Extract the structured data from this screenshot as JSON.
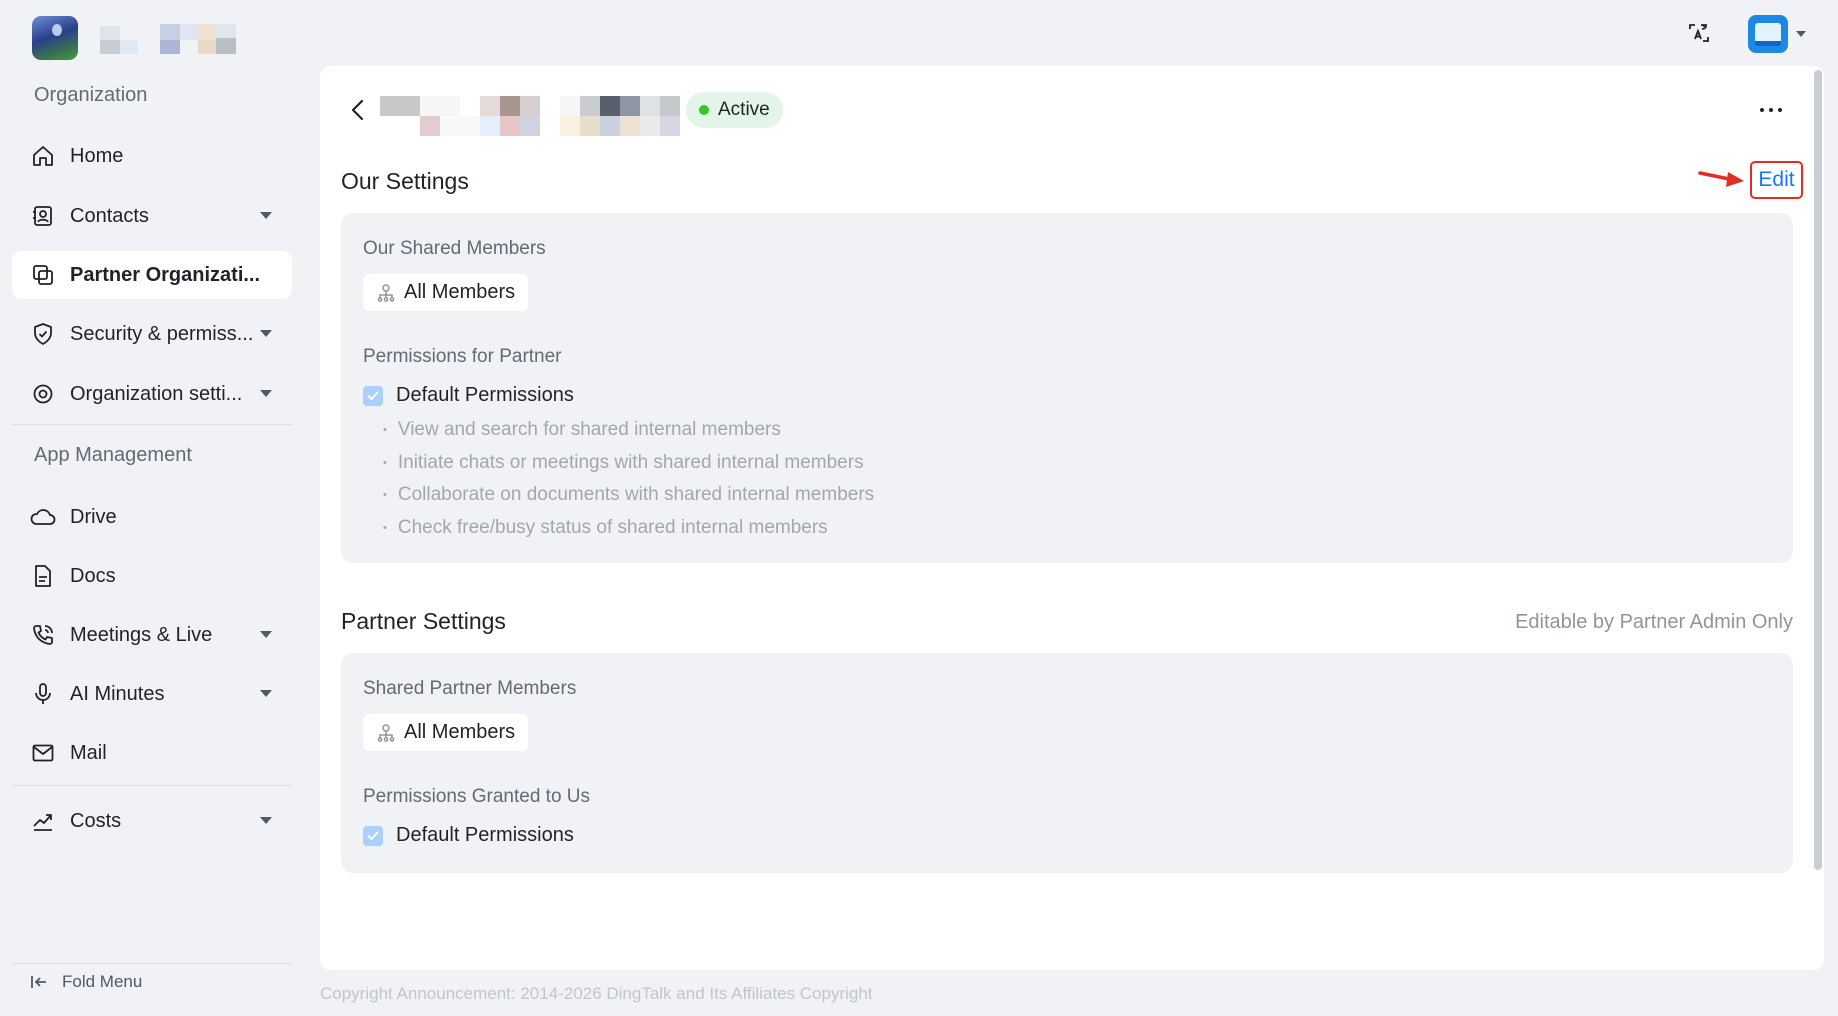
{
  "sidebar": {
    "section_org": "Organization",
    "section_apps": "App Management",
    "items": [
      {
        "label": "Home",
        "icon": "home-icon"
      },
      {
        "label": "Contacts",
        "icon": "contacts-icon"
      },
      {
        "label": "Partner Organizati...",
        "icon": "partner-org-icon"
      },
      {
        "label": "Security & permiss...",
        "icon": "shield-icon"
      },
      {
        "label": "Organization setti...",
        "icon": "settings-icon"
      },
      {
        "label": "Drive",
        "icon": "cloud-icon"
      },
      {
        "label": "Docs",
        "icon": "doc-icon"
      },
      {
        "label": "Meetings & Live",
        "icon": "meeting-icon"
      },
      {
        "label": "AI Minutes",
        "icon": "mic-icon"
      },
      {
        "label": "Mail",
        "icon": "mail-icon"
      },
      {
        "label": "Costs",
        "icon": "trend-icon"
      }
    ],
    "fold_menu": "Fold Menu"
  },
  "header": {
    "status": "Active",
    "status_color": "#34c724"
  },
  "our_settings": {
    "title": "Our Settings",
    "edit_label": "Edit",
    "shared_members_label": "Our Shared Members",
    "shared_members_value": "All Members",
    "permissions_label": "Permissions for Partner",
    "default_permissions": "Default Permissions",
    "permission_items": [
      "View and search for shared internal members",
      "Initiate chats or meetings with shared internal members",
      "Collaborate on documents with shared internal members",
      "Check free/busy status of shared internal members"
    ]
  },
  "partner_settings": {
    "title": "Partner Settings",
    "note": "Editable by Partner Admin Only",
    "shared_members_label": "Shared Partner Members",
    "shared_members_value": "All Members",
    "permissions_label": "Permissions Granted to Us",
    "default_permissions": "Default Permissions"
  },
  "footer": "Copyright Announcement: 2014-2026 DingTalk and Its Affiliates Copyright",
  "colors": {
    "accent": "#1677ff",
    "annotation": "#e02e24",
    "page_bg": "#f1f2f5"
  }
}
